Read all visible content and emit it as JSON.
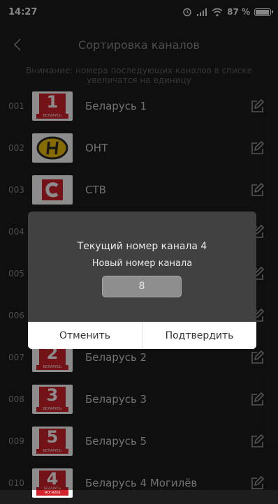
{
  "status": {
    "time": "14:27",
    "battery": "87 %"
  },
  "header": {
    "title": "Сортировка каналов"
  },
  "notice": "Внимание: номера последующих каналов в списке увеличатся на единицу",
  "channels": [
    {
      "num": "001",
      "name": "Беларусь 1",
      "logo": "belarus-1-logo"
    },
    {
      "num": "002",
      "name": "ОНТ",
      "logo": "ont-logo"
    },
    {
      "num": "003",
      "name": "СТВ",
      "logo": "ctv-logo"
    },
    {
      "num": "004",
      "name": "",
      "logo": ""
    },
    {
      "num": "005",
      "name": "",
      "logo": ""
    },
    {
      "num": "006",
      "name": "",
      "logo": ""
    },
    {
      "num": "007",
      "name": "Беларусь 2",
      "logo": "belarus-2-logo"
    },
    {
      "num": "008",
      "name": "Беларусь 3",
      "logo": "belarus-3-logo"
    },
    {
      "num": "009",
      "name": "Беларусь 5",
      "logo": "belarus-5-logo"
    },
    {
      "num": "010",
      "name": "Беларусь 4 Могилёв",
      "logo": "belarus-4-mogilev-logo"
    }
  ],
  "logo_text": {
    "belarus": "БЕЛАРУСЬ",
    "mogilev": "МОГИЛЁВ",
    "one": "1",
    "two": "2",
    "three": "3",
    "five": "5",
    "four": "4"
  },
  "dialog": {
    "current": "Текущий номер канала 4",
    "new_label": "Новый номер канала",
    "input_value": "8",
    "cancel": "Отменить",
    "confirm": "Подтвердить"
  },
  "colors": {
    "background": "#1d1d1d",
    "belarus_red": "#d2232a",
    "ont_yellow": "#f5c400",
    "edit_icon": "#9a9a9a"
  }
}
